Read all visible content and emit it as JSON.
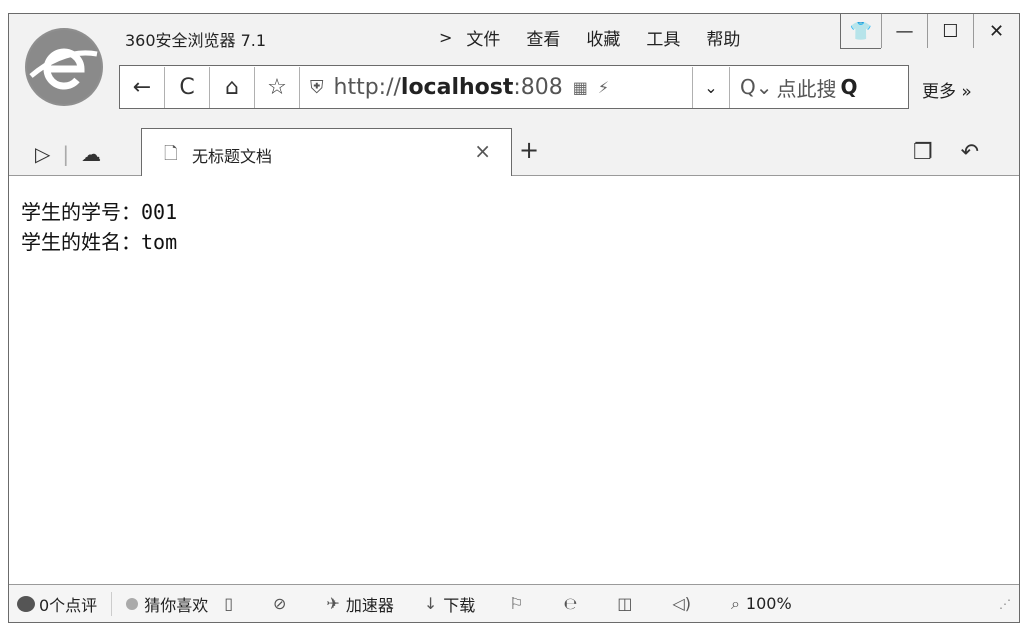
{
  "window": {
    "app_title": "360安全浏览器 7.1",
    "menu_arrow": ">",
    "menu": [
      "文件",
      "查看",
      "收藏",
      "工具",
      "帮助"
    ],
    "controls": {
      "skin": "👕",
      "minimize": "—",
      "maximize": "☐",
      "close": "✕"
    }
  },
  "nav": {
    "back": "←",
    "reload": "C",
    "home": "⌂",
    "favorite": "☆",
    "address_prefix": "http://",
    "address_host": "localhost",
    "address_port": ":808",
    "dropdown": "⌄",
    "search_placeholder": "点此搜",
    "more": "更多 »"
  },
  "tabs": {
    "active_tab_title": "无标题文档",
    "close": "×",
    "new_tab": "+"
  },
  "content": {
    "line1_label": "学生的学号：",
    "line1_value": "001",
    "line2_label": "学生的姓名：",
    "line2_value": "tom"
  },
  "status": {
    "reviews": "0个点评",
    "guess": "猜你喜欢",
    "accelerator": "加速器",
    "download": "下载",
    "zoom": "100%"
  }
}
